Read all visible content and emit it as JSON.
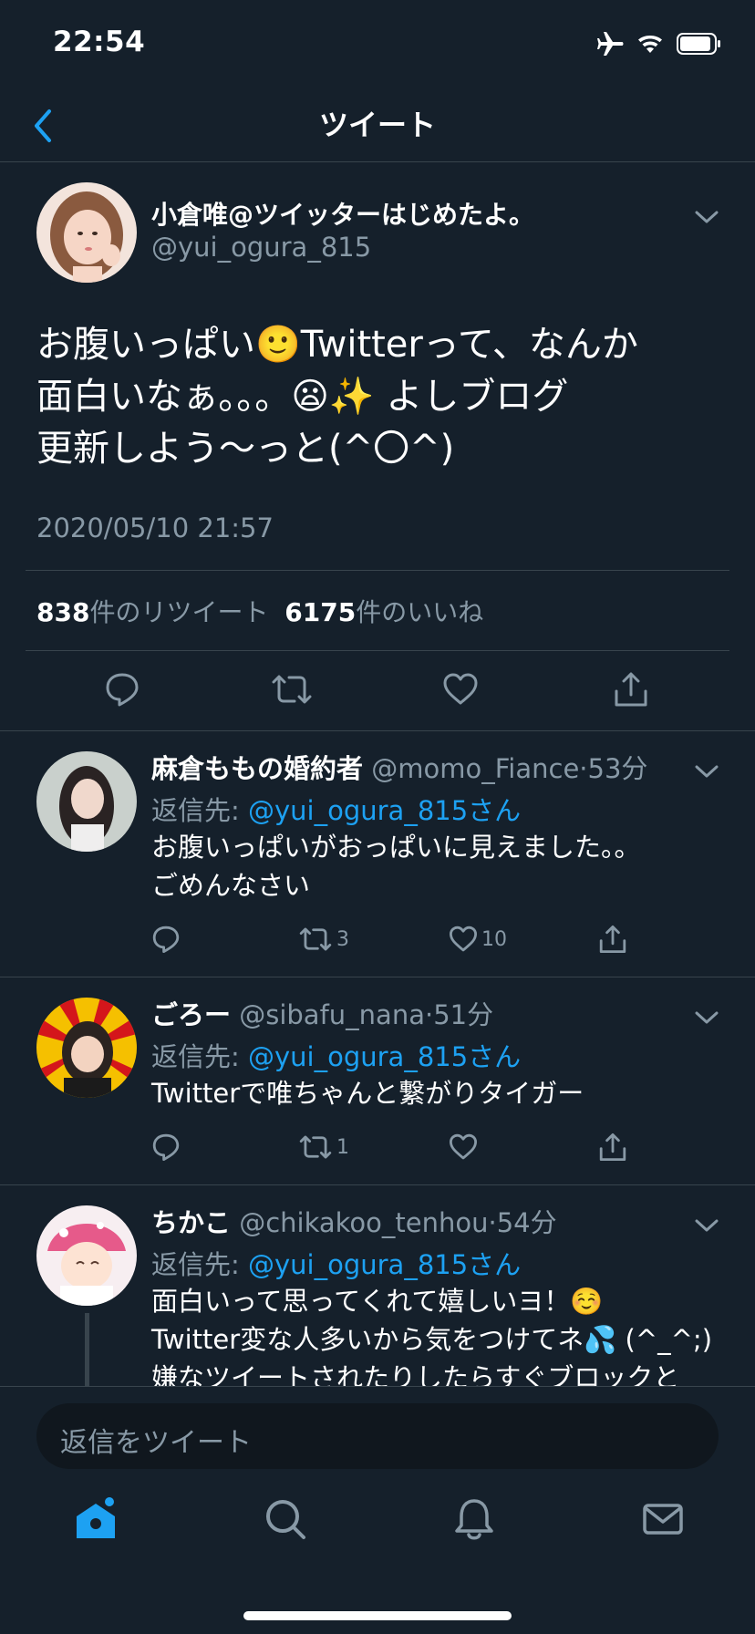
{
  "status_bar": {
    "time": "22:54"
  },
  "nav": {
    "title": "ツイート"
  },
  "main_tweet": {
    "name": "小倉唯@ツイッターはじめたよ。",
    "handle": "@yui_ogura_815",
    "body_line1": "お腹いっぱい🙂Twitterって、なんか",
    "body_line2": "面白いなぁ。。。😦✨ よしブログ",
    "body_line3": "更新しよう〜っと(^〇^)",
    "date": "2020/05/10 21:57",
    "retweet_count": "838",
    "retweet_label": "件のリツイート",
    "like_count": "6175",
    "like_label": "件のいいね"
  },
  "replies": [
    {
      "name": "麻倉ももの婚約者",
      "handle": "@momo_Fiance",
      "time": "53分",
      "reply_prefix": "返信先: ",
      "reply_to": "@yui_ogura_815さん",
      "body_line1": "お腹いっぱいがおっぱいに見えました。。",
      "body_line2": "ごめんなさい",
      "retweets": "3",
      "likes": "10"
    },
    {
      "name": "ごろー",
      "handle": "@sibafu_nana",
      "time": "51分",
      "reply_prefix": "返信先: ",
      "reply_to": "@yui_ogura_815さん",
      "body_line1": "Twitterで唯ちゃんと繋がりタイガー",
      "retweets": "1",
      "likes": ""
    },
    {
      "name": "ちかこ",
      "handle": "@chikakoo_tenhou",
      "time": "54分",
      "reply_prefix": "返信先: ",
      "reply_to": "@yui_ogura_815さん",
      "body_line1": "面白いって思ってくれて嬉しいヨ！☺️",
      "body_line2": "Twitter変な人多いから気をつけてネ💦 (^_^;)",
      "body_line3": "嫌なツイートされたりしたらすぐブロックと"
    }
  ],
  "composer": {
    "placeholder": "返信をツイート"
  },
  "colors": {
    "background": "#15202b",
    "accent": "#1da1f2",
    "muted": "#8899a6",
    "divider": "#38444d"
  }
}
